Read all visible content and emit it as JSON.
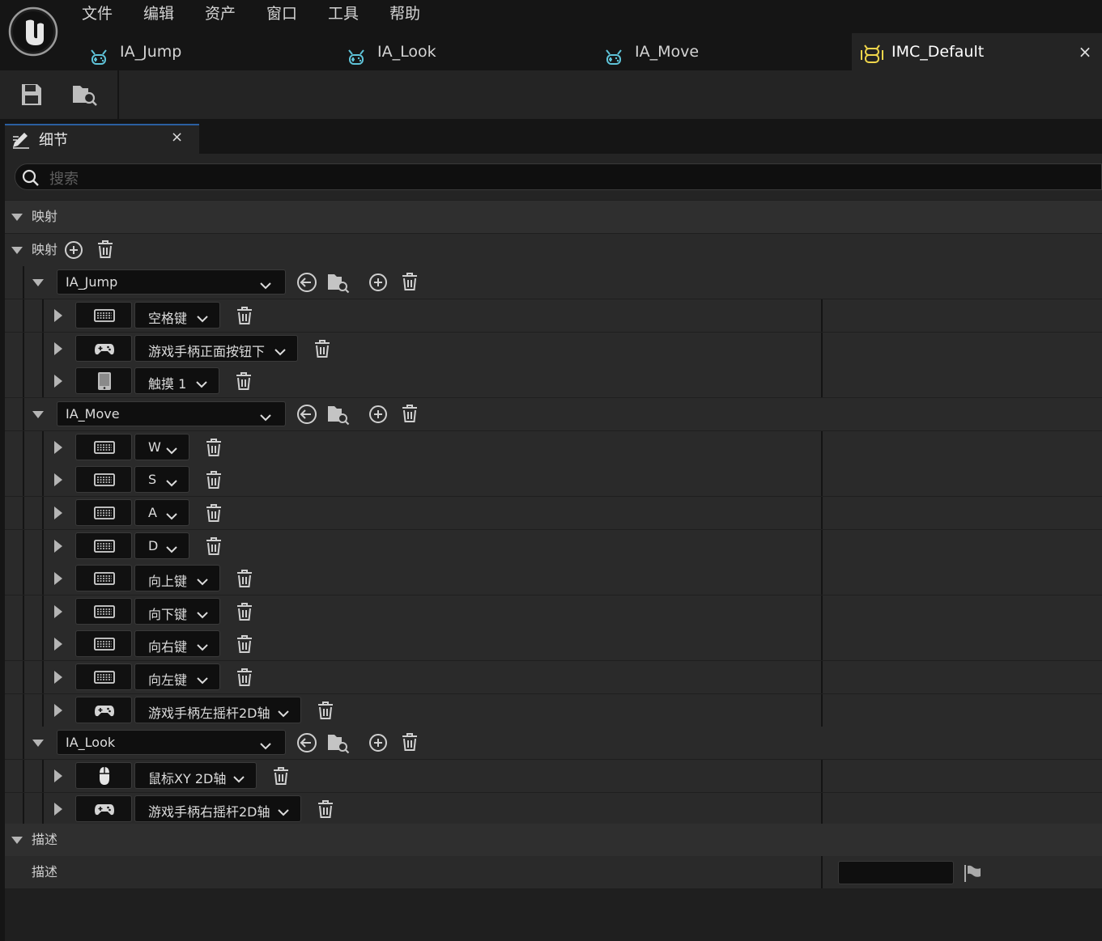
{
  "menu": [
    "文件",
    "编辑",
    "资产",
    "窗口",
    "工具",
    "帮助"
  ],
  "tabs": [
    {
      "label": "IA_Jump",
      "icon": "input-action-icon"
    },
    {
      "label": "IA_Look",
      "icon": "input-action-icon"
    },
    {
      "label": "IA_Move",
      "icon": "input-action-icon"
    },
    {
      "label": "IMC_Default",
      "icon": "input-mapping-context-icon",
      "active": true
    }
  ],
  "tab_close": "×",
  "toolbar": {
    "save": "save-icon",
    "browse": "browse-asset-icon"
  },
  "details": {
    "title": "细节",
    "close": "×"
  },
  "search": {
    "placeholder": "搜索"
  },
  "sections": {
    "mappings_header": "映射",
    "mappings_label": "映射",
    "description_header": "描述",
    "description_label": "描述"
  },
  "actions": [
    {
      "name": "IA_Jump",
      "keys": [
        {
          "device": "keyboard",
          "label": "空格键"
        },
        {
          "device": "gamepad",
          "label": "游戏手柄正面按钮下"
        },
        {
          "device": "touch",
          "label": "触摸 1"
        }
      ]
    },
    {
      "name": "IA_Move",
      "keys": [
        {
          "device": "keyboard",
          "label": "W"
        },
        {
          "device": "keyboard",
          "label": "S"
        },
        {
          "device": "keyboard",
          "label": "A"
        },
        {
          "device": "keyboard",
          "label": "D"
        },
        {
          "device": "keyboard",
          "label": "向上键"
        },
        {
          "device": "keyboard",
          "label": "向下键"
        },
        {
          "device": "keyboard",
          "label": "向右键"
        },
        {
          "device": "keyboard",
          "label": "向左键"
        },
        {
          "device": "gamepad",
          "label": "游戏手柄左摇杆2D轴"
        }
      ]
    },
    {
      "name": "IA_Look",
      "keys": [
        {
          "device": "mouse",
          "label": "鼠标XY 2D轴"
        },
        {
          "device": "gamepad",
          "label": "游戏手柄右摇杆2D轴"
        }
      ]
    }
  ],
  "colors": {
    "accent": "#2b5fa0",
    "input_action_icon": "#5fc3d8",
    "mapping_context_icon": "#f0d64b"
  }
}
